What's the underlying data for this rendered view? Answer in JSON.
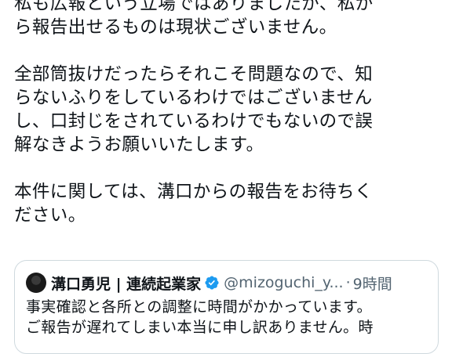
{
  "tweet": {
    "lines": [
      "私も広報という立場ではありましたが、私か",
      "ら報告出せるものは現状ございません。",
      "",
      "全部筒抜けだったらそれこそ問題なので、知",
      "らないふりをしているわけではございません",
      "し、口封じをされているわけでもないので誤",
      "解なきようお願いいたします。",
      "",
      "本件に関しては、溝口からの報告をお待ちく",
      "ださい。"
    ]
  },
  "quote": {
    "author_name": "溝口勇児 | 連続起業家",
    "handle": "@mizoguchi_y...",
    "dot": "·",
    "time": "9時間",
    "lines": [
      "事実確認と各所との調整に時間がかかっています。",
      "ご報告が遅れてしまい本当に申し訳ありません。時"
    ]
  },
  "colors": {
    "text": "#0f1419",
    "muted": "#536471",
    "verified": "#1d9bf0",
    "border": "#cfd9de"
  },
  "icons": {
    "verified": "verified-badge-icon",
    "avatar": "profile-photo"
  }
}
